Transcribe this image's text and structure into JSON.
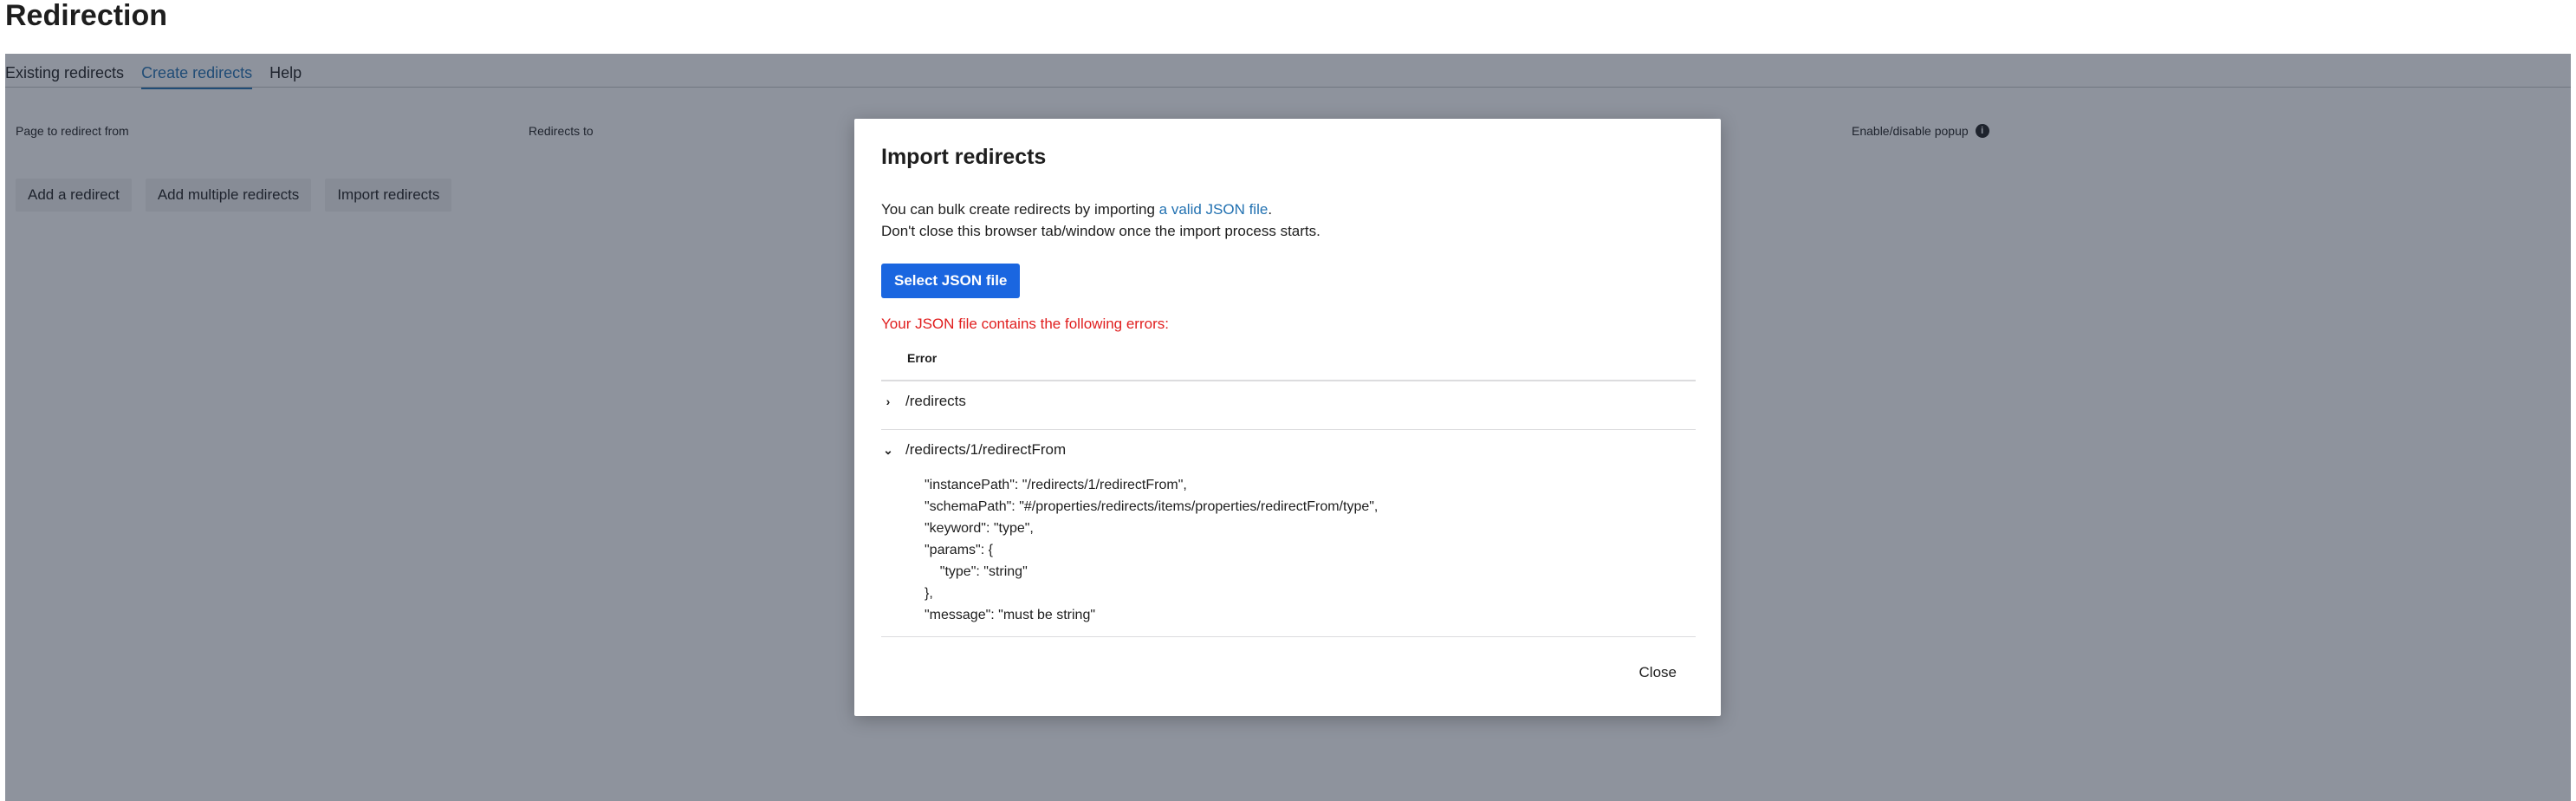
{
  "page": {
    "title": "Redirection"
  },
  "tabs": [
    {
      "label": "Existing redirects",
      "active": false
    },
    {
      "label": "Create redirects",
      "active": true
    },
    {
      "label": "Help",
      "active": false
    }
  ],
  "table": {
    "columns": [
      "Page to redirect from",
      "Redirects to",
      "Enable/disable popup"
    ]
  },
  "actions": {
    "add": "Add a redirect",
    "add_multiple": "Add multiple redirects",
    "import": "Import redirects"
  },
  "modal": {
    "title": "Import redirects",
    "desc_prefix": "You can bulk create redirects by importing ",
    "desc_link": "a valid JSON file",
    "desc_suffix": ".",
    "desc_line2": "Don't close this browser tab/window once the import process starts.",
    "select_button": "Select JSON file",
    "error_message": "Your JSON file contains the following errors:",
    "error_column": "Error",
    "errors": [
      {
        "path": "/redirects",
        "expanded": false
      },
      {
        "path": "/redirects/1/redirectFrom",
        "expanded": true
      }
    ],
    "error_detail": "\"instancePath\": \"/redirects/1/redirectFrom\",\n\"schemaPath\": \"#/properties/redirects/items/properties/redirectFrom/type\",\n\"keyword\": \"type\",\n\"params\": {\n    \"type\": \"string\"\n},\n\"message\": \"must be string\"",
    "close_button": "Close"
  },
  "colors": {
    "accent": "#2271b1",
    "primary_button": "#1a66e0",
    "error": "#e01e1e"
  }
}
